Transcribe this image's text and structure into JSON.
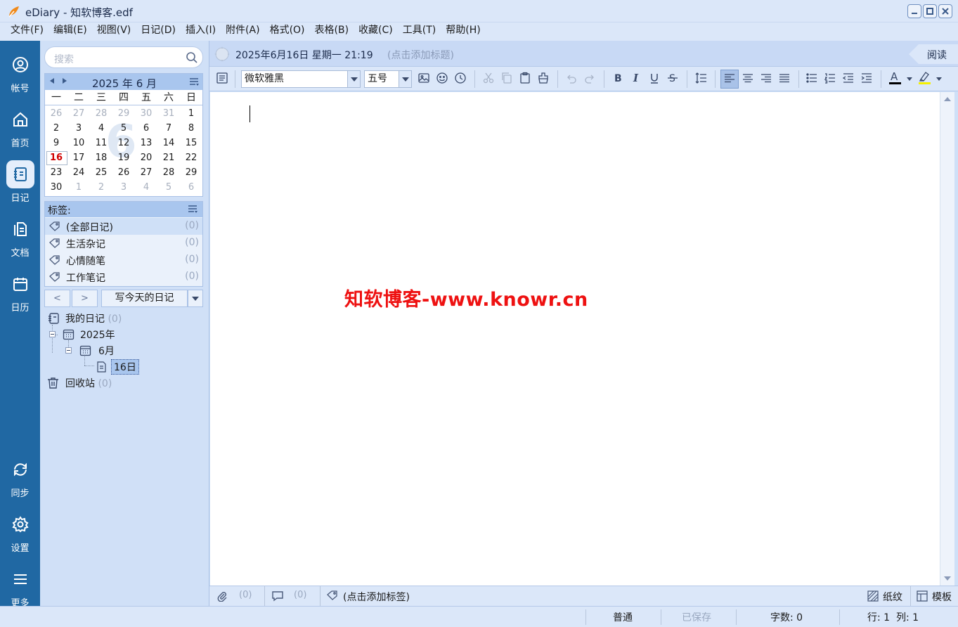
{
  "window": {
    "title": "eDiary - 知软博客.edf"
  },
  "menu": [
    "文件(F)",
    "编辑(E)",
    "视图(V)",
    "日记(D)",
    "插入(I)",
    "附件(A)",
    "格式(O)",
    "表格(B)",
    "收藏(C)",
    "工具(T)",
    "帮助(H)"
  ],
  "nav": {
    "account": "帐号",
    "home": "首页",
    "diary": "日记",
    "docs": "文档",
    "calendar": "日历",
    "sync": "同步",
    "settings": "设置",
    "more": "更多"
  },
  "search": {
    "placeholder": "搜索"
  },
  "calendar": {
    "title": "2025 年 6 月",
    "big_month": "6",
    "weekdays": [
      "一",
      "二",
      "三",
      "四",
      "五",
      "六",
      "日"
    ],
    "weeks": [
      [
        "26",
        "27",
        "28",
        "29",
        "30",
        "31",
        "1"
      ],
      [
        "2",
        "3",
        "4",
        "5",
        "6",
        "7",
        "8"
      ],
      [
        "9",
        "10",
        "11",
        "12",
        "13",
        "14",
        "15"
      ],
      [
        "16",
        "17",
        "18",
        "19",
        "20",
        "21",
        "22"
      ],
      [
        "23",
        "24",
        "25",
        "26",
        "27",
        "28",
        "29"
      ],
      [
        "30",
        "1",
        "2",
        "3",
        "4",
        "5",
        "6"
      ]
    ],
    "today": "16"
  },
  "tags": {
    "header": "标签:",
    "items": [
      {
        "label": "(全部日记)",
        "count": "(0)"
      },
      {
        "label": "生活杂记",
        "count": "(0)"
      },
      {
        "label": "心情随笔",
        "count": "(0)"
      },
      {
        "label": "工作笔记",
        "count": "(0)"
      }
    ]
  },
  "buttons": {
    "prev": "<",
    "next": ">",
    "write_today": "写今天的日记"
  },
  "tree": {
    "root": "我的日记",
    "root_count": "(0)",
    "year": "2025年",
    "month": "6月",
    "day": "16日",
    "trash": "回收站",
    "trash_count": "(0)"
  },
  "entry": {
    "date": "2025年6月16日 星期一 21:19",
    "title_placeholder": "(点击添加标题)",
    "read_button": "阅读"
  },
  "toolbar": {
    "font": "微软雅黑",
    "size": "五号"
  },
  "editor": {
    "watermark": "知软博客-www.knowr.cn"
  },
  "footer": {
    "attach_count": "(0)",
    "comment_count": "(0)",
    "tag_placeholder": "(点击添加标签)",
    "paper": "纸纹",
    "template": "模板"
  },
  "status": {
    "mode": "普通",
    "saved": "已保存",
    "words": "字数: 0",
    "pos": "行: 1  列: 1"
  }
}
